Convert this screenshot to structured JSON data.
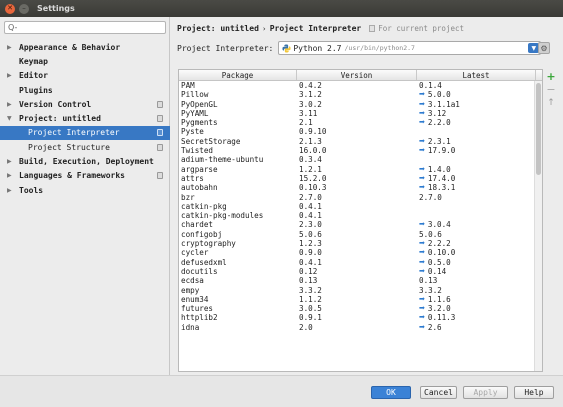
{
  "window": {
    "title": "Settings"
  },
  "sidebar": {
    "search_placeholder": "Q-",
    "items": [
      {
        "label": "Appearance & Behavior",
        "arrow": "▶",
        "level": 0,
        "icon": false
      },
      {
        "label": "Keymap",
        "arrow": "",
        "level": 0,
        "icon": false
      },
      {
        "label": "Editor",
        "arrow": "▶",
        "level": 0,
        "icon": false
      },
      {
        "label": "Plugins",
        "arrow": "",
        "level": 0,
        "icon": false
      },
      {
        "label": "Version Control",
        "arrow": "▶",
        "level": 0,
        "icon": true
      },
      {
        "label": "Project: untitled",
        "arrow": "▼",
        "level": 0,
        "icon": true
      },
      {
        "label": "Project Interpreter",
        "arrow": "",
        "level": 1,
        "icon": true,
        "selected": true
      },
      {
        "label": "Project Structure",
        "arrow": "",
        "level": 1,
        "icon": true
      },
      {
        "label": "Build, Execution, Deployment",
        "arrow": "▶",
        "level": 0,
        "icon": false
      },
      {
        "label": "Languages & Frameworks",
        "arrow": "▶",
        "level": 0,
        "icon": true
      },
      {
        "label": "Tools",
        "arrow": "▶",
        "level": 0,
        "icon": false
      }
    ]
  },
  "breadcrumb": {
    "project": "Project: untitled",
    "separator": "›",
    "page": "Project Interpreter",
    "hint": "For current project"
  },
  "interpreter": {
    "label": "Project Interpreter:",
    "value": "Python 2.7",
    "path": "/usr/bin/python2.7"
  },
  "table": {
    "headers": [
      "Package",
      "Version",
      "Latest"
    ],
    "upgrade_icon": "arrow-right-upgrade-icon",
    "rows": [
      {
        "package": "PAM",
        "version": "0.4.2",
        "latest": "0.1.4",
        "upgrade": false
      },
      {
        "package": "Pillow",
        "version": "3.1.2",
        "latest": "5.0.0",
        "upgrade": true
      },
      {
        "package": "PyOpenGL",
        "version": "3.0.2",
        "latest": "3.1.1a1",
        "upgrade": true
      },
      {
        "package": "PyYAML",
        "version": "3.11",
        "latest": "3.12",
        "upgrade": true
      },
      {
        "package": "Pygments",
        "version": "2.1",
        "latest": "2.2.0",
        "upgrade": true
      },
      {
        "package": "Pyste",
        "version": "0.9.10",
        "latest": "",
        "upgrade": false
      },
      {
        "package": "SecretStorage",
        "version": "2.1.3",
        "latest": "2.3.1",
        "upgrade": true
      },
      {
        "package": "Twisted",
        "version": "16.0.0",
        "latest": "17.9.0",
        "upgrade": true
      },
      {
        "package": "adium-theme-ubuntu",
        "version": "0.3.4",
        "latest": "",
        "upgrade": false
      },
      {
        "package": "argparse",
        "version": "1.2.1",
        "latest": "1.4.0",
        "upgrade": true
      },
      {
        "package": "attrs",
        "version": "15.2.0",
        "latest": "17.4.0",
        "upgrade": true
      },
      {
        "package": "autobahn",
        "version": "0.10.3",
        "latest": "18.3.1",
        "upgrade": true
      },
      {
        "package": "bzr",
        "version": "2.7.0",
        "latest": "2.7.0",
        "upgrade": false
      },
      {
        "package": "catkin-pkg",
        "version": "0.4.1",
        "latest": "",
        "upgrade": false
      },
      {
        "package": "catkin-pkg-modules",
        "version": "0.4.1",
        "latest": "",
        "upgrade": false
      },
      {
        "package": "chardet",
        "version": "2.3.0",
        "latest": "3.0.4",
        "upgrade": true
      },
      {
        "package": "configobj",
        "version": "5.0.6",
        "latest": "5.0.6",
        "upgrade": false
      },
      {
        "package": "cryptography",
        "version": "1.2.3",
        "latest": "2.2.2",
        "upgrade": true
      },
      {
        "package": "cycler",
        "version": "0.9.0",
        "latest": "0.10.0",
        "upgrade": true
      },
      {
        "package": "defusedxml",
        "version": "0.4.1",
        "latest": "0.5.0",
        "upgrade": true
      },
      {
        "package": "docutils",
        "version": "0.12",
        "latest": "0.14",
        "upgrade": true
      },
      {
        "package": "ecdsa",
        "version": "0.13",
        "latest": "0.13",
        "upgrade": false
      },
      {
        "package": "empy",
        "version": "3.3.2",
        "latest": "3.3.2",
        "upgrade": false
      },
      {
        "package": "enum34",
        "version": "1.1.2",
        "latest": "1.1.6",
        "upgrade": true
      },
      {
        "package": "futures",
        "version": "3.0.5",
        "latest": "3.2.0",
        "upgrade": true
      },
      {
        "package": "httplib2",
        "version": "0.9.1",
        "latest": "0.11.3",
        "upgrade": true
      },
      {
        "package": "idna",
        "version": "2.0",
        "latest": "2.6",
        "upgrade": true
      }
    ]
  },
  "tools": {
    "add": "+",
    "remove": "−",
    "upgrade": "↑"
  },
  "buttons": {
    "ok": "OK",
    "cancel": "Cancel",
    "apply": "Apply",
    "help": "Help"
  },
  "colors": {
    "selection": "#3878c4",
    "upgrade_arrow": "#2d7bd0",
    "add_green": "#3aa63a",
    "close_button": "#e8663c"
  }
}
